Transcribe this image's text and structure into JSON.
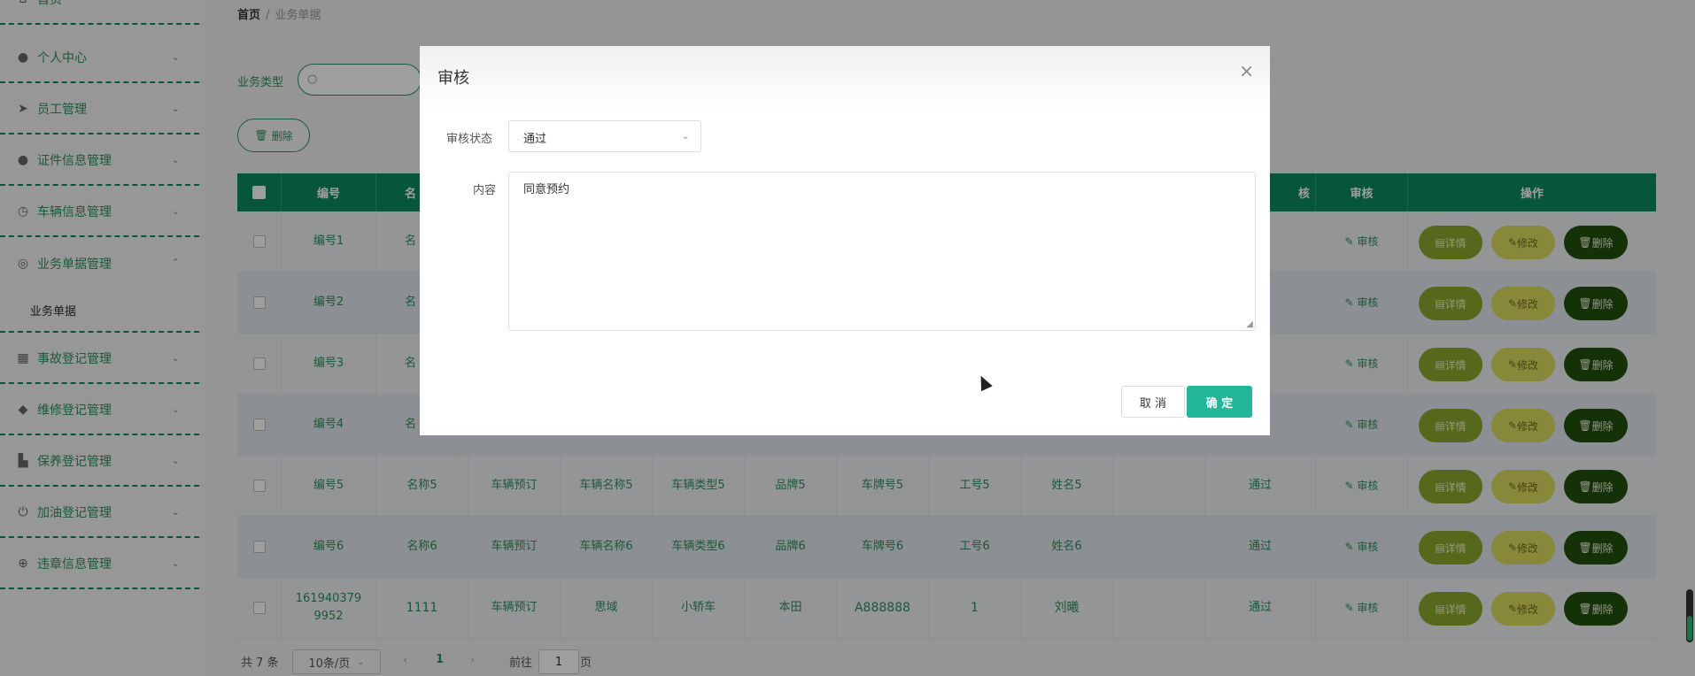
{
  "sidebar": {
    "items": [
      {
        "label": "首页",
        "icon": "home-icon"
      },
      {
        "label": "个人中心",
        "icon": "user-icon"
      },
      {
        "label": "员工管理",
        "icon": "send-icon"
      },
      {
        "label": "证件信息管理",
        "icon": "user-icon"
      },
      {
        "label": "车辆信息管理",
        "icon": "clock-icon"
      },
      {
        "label": "业务单据管理",
        "icon": "compass-icon"
      },
      {
        "label": "事故登记管理",
        "icon": "grid-icon"
      },
      {
        "label": "维修登记管理",
        "icon": "location-icon"
      },
      {
        "label": "保养登记管理",
        "icon": "factory-icon"
      },
      {
        "label": "加油登记管理",
        "icon": "power-icon"
      },
      {
        "label": "违章信息管理",
        "icon": "target-icon"
      }
    ],
    "submenu": "业务单据"
  },
  "breadcrumb": {
    "home": "首页",
    "separator": "/",
    "current": "业务单据"
  },
  "filter": {
    "label": "业务类型"
  },
  "toolbar": {
    "delete_label": "删除"
  },
  "table": {
    "headers": [
      "编号",
      "名",
      "核",
      "审核",
      "操作"
    ],
    "rows": [
      {
        "id": "编号1",
        "name": "名",
        "cells": []
      },
      {
        "id": "编号2",
        "name": "名",
        "cells": []
      },
      {
        "id": "编号3",
        "name": "名",
        "cells": []
      },
      {
        "id": "编号4",
        "name": "名",
        "cells": []
      },
      {
        "id": "编号5",
        "name": "名称5",
        "cells": [
          "车辆预订",
          "车辆名称5",
          "车辆类型5",
          "品牌5",
          "车牌号5",
          "工号5",
          "姓名5",
          "",
          "通过"
        ]
      },
      {
        "id": "编号6",
        "name": "名称6",
        "cells": [
          "车辆预订",
          "车辆名称6",
          "车辆类型6",
          "品牌6",
          "车牌号6",
          "工号6",
          "姓名6",
          "",
          "通过"
        ]
      },
      {
        "id": "1619403799952",
        "name": "1111",
        "cells": [
          "车辆预订",
          "思域",
          "小轿车",
          "本田",
          "A888888",
          "1",
          "刘曦",
          "",
          "通过"
        ]
      }
    ],
    "audit_link": "审核",
    "actions": {
      "detail": "详情",
      "edit": "修改",
      "delete": "删除"
    }
  },
  "pagination": {
    "total": "共 7 条",
    "page_size": "10条/页",
    "current_page": "1",
    "goto_prefix": "前往",
    "goto_value": "1",
    "goto_suffix": "页"
  },
  "dialog": {
    "title": "审核",
    "status_label": "审核状态",
    "status_value": "通过",
    "content_label": "内容",
    "content_value": "同意预约",
    "cancel_label": "取 消",
    "confirm_label": "确 定"
  },
  "colors": {
    "primary": "#0c8a5e",
    "text_accent": "#2e8f5c",
    "confirm": "#23b79a",
    "detail": "#8aa82c",
    "edit": "#dadb5d",
    "delete": "#234f0e"
  }
}
